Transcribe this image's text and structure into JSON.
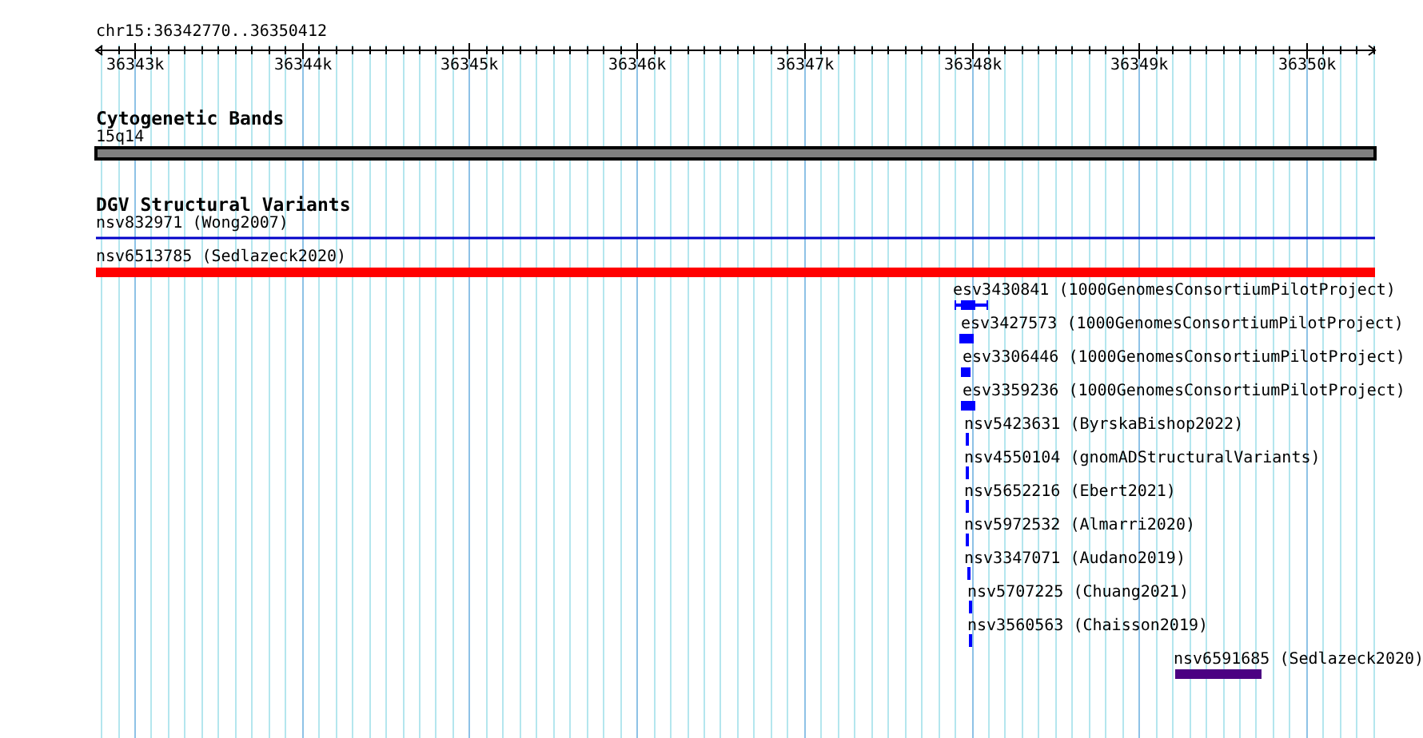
{
  "location": "chr15:36342770..36350412",
  "ruler": {
    "ticks": [
      "36343k",
      "36344k",
      "36345k",
      "36346k",
      "36347k",
      "36348k",
      "36349k",
      "36350k"
    ]
  },
  "tracks": [
    {
      "title": "Cytogenetic Bands",
      "features": [
        {
          "label": "15q14",
          "kind": "band",
          "color": "#808080"
        }
      ]
    },
    {
      "title": "DGV Structural Variants",
      "features": [
        {
          "label": "nsv832971 (Wong2007)",
          "kind": "line",
          "color": "#0000c8"
        },
        {
          "label": "nsv6513785 (Sedlazeck2020)",
          "kind": "bar",
          "color": "#ff0000"
        },
        {
          "label": "esv3430841 (1000GenomesConsortiumPilotProject)",
          "kind": "interval",
          "color": "#0000ff"
        },
        {
          "label": "esv3427573 (1000GenomesConsortiumPilotProject)",
          "kind": "bar",
          "color": "#0000ff"
        },
        {
          "label": "esv3306446 (1000GenomesConsortiumPilotProject)",
          "kind": "bar",
          "color": "#0000ff"
        },
        {
          "label": "esv3359236 (1000GenomesConsortiumPilotProject)",
          "kind": "bar",
          "color": "#0000ff"
        },
        {
          "label": "nsv5423631 (ByrskaBishop2022)",
          "kind": "tick",
          "color": "#0000ff"
        },
        {
          "label": "nsv4550104 (gnomADStructuralVariants)",
          "kind": "tick",
          "color": "#0000ff"
        },
        {
          "label": "nsv5652216 (Ebert2021)",
          "kind": "tick",
          "color": "#0000ff"
        },
        {
          "label": "nsv5972532 (Almarri2020)",
          "kind": "tick",
          "color": "#0000ff"
        },
        {
          "label": "nsv3347071 (Audano2019)",
          "kind": "tick",
          "color": "#0000ff"
        },
        {
          "label": "nsv5707225 (Chuang2021)",
          "kind": "tick",
          "color": "#0000ff"
        },
        {
          "label": "nsv3560563 (Chaisson2019)",
          "kind": "tick",
          "color": "#0000ff"
        },
        {
          "label": "nsv6591685 (Sedlazeck2020)",
          "kind": "bar",
          "color": "#4b0082"
        }
      ]
    }
  ]
}
